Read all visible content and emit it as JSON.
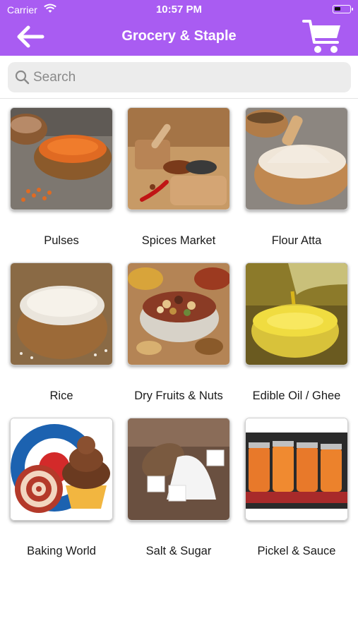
{
  "status_bar": {
    "carrier": "Carrier",
    "time": "10:57 PM"
  },
  "header": {
    "title": "Grocery & Staple",
    "back_icon": "arrow-left-icon",
    "cart_icon": "cart-icon"
  },
  "colors": {
    "header_bg": "#a95cf2",
    "search_bg": "#ececec"
  },
  "search": {
    "placeholder": "Search",
    "value": ""
  },
  "categories": [
    {
      "label": "Pulses"
    },
    {
      "label": "Spices Market"
    },
    {
      "label": "Flour Atta"
    },
    {
      "label": "Rice"
    },
    {
      "label": "Dry Fruits & Nuts"
    },
    {
      "label": "Edible Oil / Ghee"
    },
    {
      "label": "Baking World"
    },
    {
      "label": "Salt & Sugar"
    },
    {
      "label": "Pickel & Sauce"
    }
  ]
}
